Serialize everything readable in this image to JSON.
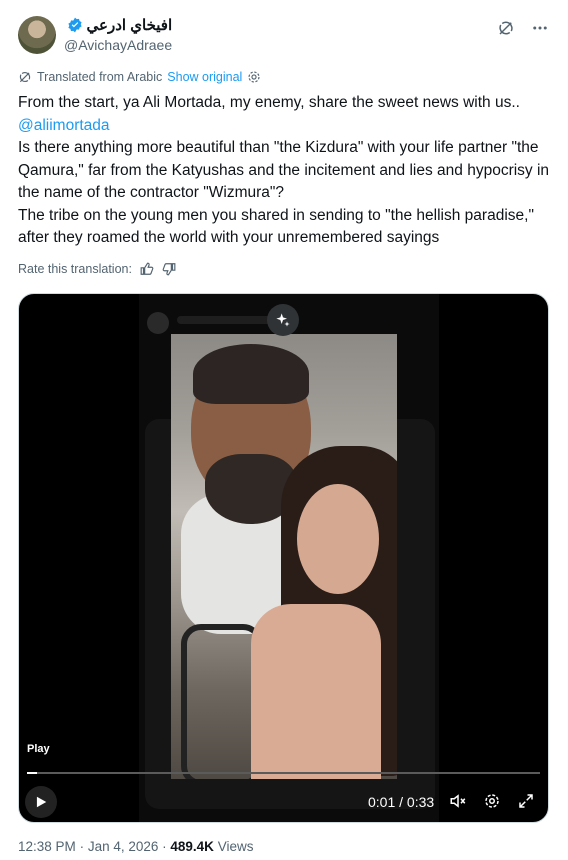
{
  "author": {
    "display_name": "افيخاي ادرعي",
    "handle": "@AvichayAdraee",
    "verified": true,
    "avatar_icon": "avatar-soldier"
  },
  "header_icons": [
    "grok-icon",
    "more-icon"
  ],
  "translation": {
    "label": "Translated from Arabic",
    "show_original": "Show original",
    "rate_label": "Rate this translation:"
  },
  "tweet": {
    "line1": "From the start, ya Ali Mortada, my enemy, share the sweet news with us..",
    "mention": "@aliimortada",
    "line2": "Is there anything more beautiful than \"the Kizdura\" with your life partner \"the Qamura,\" far from the Katyushas and the incitement and lies and hypocrisy in the name of the contractor \"Wizmura\"?",
    "line3": "The tribe on the young men you shared in sending to \"the hellish paradise,\" after they roamed the world with your unremembered sayings"
  },
  "video": {
    "play_label": "Play",
    "time": "0:01 / 0:33",
    "progress_fraction": 0.02
  },
  "footer": {
    "time": "12:38 PM",
    "date": "Jan 4, 2026",
    "views_count": "489.4K",
    "views_label": "Views"
  },
  "colors": {
    "accent": "#1d9bf0",
    "muted": "#536471",
    "text": "#0f1419"
  }
}
